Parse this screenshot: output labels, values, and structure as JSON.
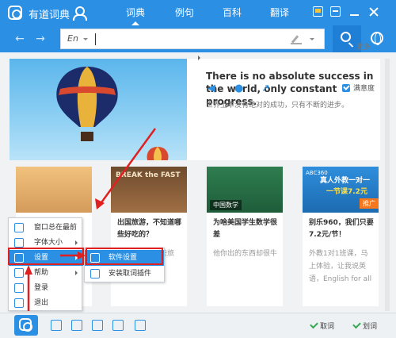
{
  "app": {
    "title": "有道词典"
  },
  "tabs": [
    {
      "label": "词典",
      "active": true
    },
    {
      "label": "例句",
      "active": false
    },
    {
      "label": "百科",
      "active": false
    },
    {
      "label": "翻译",
      "active": false
    }
  ],
  "search": {
    "lang": "En",
    "value": ""
  },
  "hero": {
    "sentence": "There is no absolute success in the world, only constant progress.",
    "translation": "世界上本没有绝对的成功，只有不断的进步。",
    "more": "更多",
    "satisfaction_label": "满意度"
  },
  "cards": [
    {
      "title": "",
      "desc": "",
      "tag": ""
    },
    {
      "image_text": "BREAK the FAST",
      "title": "出国旅游，不知道哪些好吃的？",
      "desc": "你该收藏起这些旅",
      "tag": ""
    },
    {
      "image_text": "",
      "title": "为啥美国学生数学很差",
      "desc": "他你出的东西却很牛",
      "tag": "中国数学"
    },
    {
      "image_text": "ABC360",
      "image_title": "真人外教一对一",
      "image_sub": "一节课7.2元",
      "image_tag": "推广",
      "title": "别乐960，我们只要7.2元/节！",
      "desc": "外教1对1班课，马上体验，让我说英语，English for all",
      "tag": ""
    }
  ],
  "menu": {
    "items": [
      {
        "label": "窗口总在最前",
        "icon": "window-icon",
        "has_sub": false
      },
      {
        "label": "字体大小",
        "icon": "font-icon",
        "has_sub": true
      },
      {
        "label": "设置",
        "icon": "gear-icon",
        "has_sub": true,
        "highlighted": true
      },
      {
        "label": "帮助",
        "icon": "help-icon",
        "has_sub": true
      },
      {
        "label": "登录",
        "icon": "user-icon",
        "has_sub": false
      },
      {
        "label": "退出",
        "icon": "exit-icon",
        "has_sub": false
      }
    ],
    "submenu": [
      {
        "label": "软件设置",
        "icon": "software-settings-icon",
        "highlighted": true
      },
      {
        "label": "安装取词插件",
        "icon": "install-icon",
        "highlighted": false
      }
    ]
  },
  "bottombar": {
    "checks": [
      "取词",
      "划词"
    ]
  },
  "colors": {
    "accent": "#2b8fe3",
    "highlight": "#e02020"
  }
}
